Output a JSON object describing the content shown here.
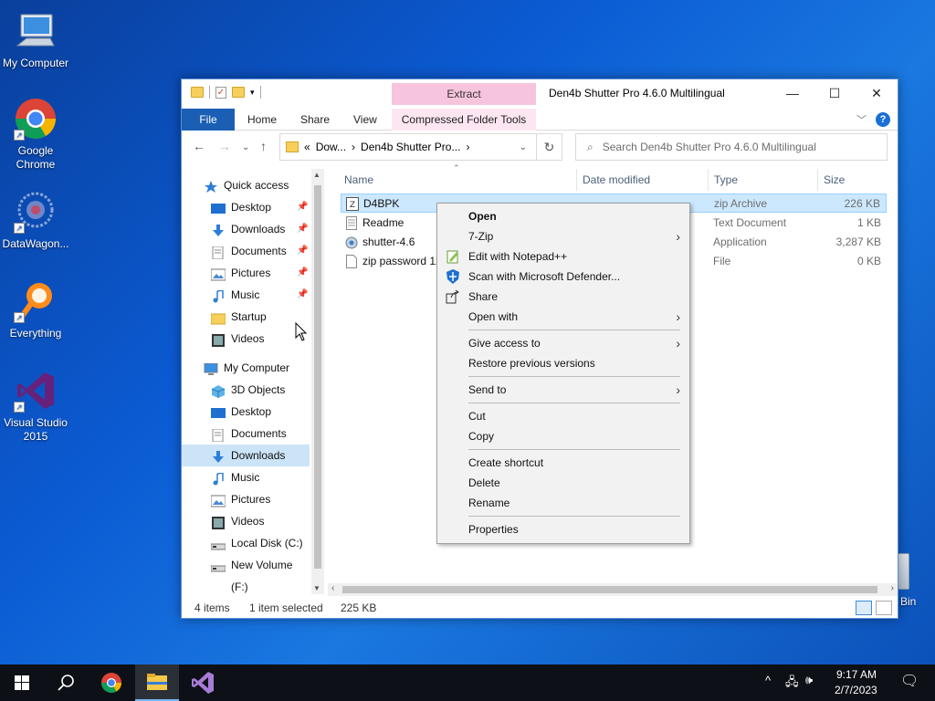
{
  "desktop": {
    "icons": [
      {
        "label": "My Computer",
        "icon": "computer-icon"
      },
      {
        "label": "Google Chrome",
        "icon": "chrome-icon"
      },
      {
        "label": "DataWagon...",
        "icon": "datawagon-icon"
      },
      {
        "label": "Everything",
        "icon": "everything-icon"
      },
      {
        "label": "Visual Studio 2015",
        "icon": "visual-studio-icon"
      }
    ],
    "recycle_bin_label": "Bin"
  },
  "window": {
    "title": "Den4b Shutter Pro 4.6.0 Multilingual",
    "context_tab": "Extract",
    "ribbon_tabs": [
      "File",
      "Home",
      "Share",
      "View",
      "Compressed Folder Tools"
    ],
    "address": {
      "crumb_prefix": "«",
      "parts": [
        "Dow...",
        "Den4b Shutter Pro..."
      ]
    },
    "search_placeholder": "Search Den4b Shutter Pro 4.6.0 Multilingual",
    "nav_pane": [
      {
        "label": "Quick access",
        "icon": "star-icon",
        "level": 0,
        "pinned": false
      },
      {
        "label": "Desktop",
        "icon": "desktop-icon",
        "level": 1,
        "pinned": true
      },
      {
        "label": "Downloads",
        "icon": "download-arrow-icon",
        "level": 1,
        "pinned": true
      },
      {
        "label": "Documents",
        "icon": "documents-icon",
        "level": 1,
        "pinned": true
      },
      {
        "label": "Pictures",
        "icon": "pictures-icon",
        "level": 1,
        "pinned": true
      },
      {
        "label": "Music",
        "icon": "music-icon",
        "level": 1,
        "pinned": true
      },
      {
        "label": "Startup",
        "icon": "folder-icon",
        "level": 1,
        "pinned": false
      },
      {
        "label": "Videos",
        "icon": "videos-icon",
        "level": 1,
        "pinned": false
      },
      {
        "label": "My Computer",
        "icon": "computer-icon",
        "level": 0,
        "pinned": false
      },
      {
        "label": "3D Objects",
        "icon": "3d-objects-icon",
        "level": 1,
        "pinned": false
      },
      {
        "label": "Desktop",
        "icon": "desktop-icon",
        "level": 1,
        "pinned": false
      },
      {
        "label": "Documents",
        "icon": "documents-icon",
        "level": 1,
        "pinned": false
      },
      {
        "label": "Downloads",
        "icon": "download-arrow-icon",
        "level": 1,
        "pinned": false,
        "selected": true
      },
      {
        "label": "Music",
        "icon": "music-icon",
        "level": 1,
        "pinned": false
      },
      {
        "label": "Pictures",
        "icon": "pictures-icon",
        "level": 1,
        "pinned": false
      },
      {
        "label": "Videos",
        "icon": "videos-icon",
        "level": 1,
        "pinned": false
      },
      {
        "label": "Local Disk (C:)",
        "icon": "drive-icon",
        "level": 1,
        "pinned": false
      },
      {
        "label": "New Volume (F:)",
        "icon": "drive-icon",
        "level": 1,
        "pinned": false
      }
    ],
    "columns": [
      "Name",
      "Date modified",
      "Type",
      "Size"
    ],
    "files": [
      {
        "name": "D4BPK",
        "type": "zip Archive",
        "size": "226 KB",
        "icon": "zip-icon",
        "selected": true
      },
      {
        "name": "Readme",
        "type": "Text Document",
        "size": "1 KB",
        "icon": "text-file-icon",
        "selected": false
      },
      {
        "name": "shutter-4.6",
        "type": "Application",
        "size": "3,287 KB",
        "icon": "installer-icon",
        "selected": false
      },
      {
        "name": "zip password 12",
        "type": "File",
        "size": "0 KB",
        "icon": "blank-file-icon",
        "selected": false
      }
    ],
    "status": {
      "count": "4 items",
      "selection": "1 item selected",
      "size": "225 KB"
    }
  },
  "context_menu": {
    "items": [
      {
        "label": "Open",
        "bold": true
      },
      {
        "label": "7-Zip",
        "submenu": true
      },
      {
        "label": "Edit with Notepad++",
        "icon": "notepad-plus-icon"
      },
      {
        "label": "Scan with Microsoft Defender...",
        "icon": "defender-icon"
      },
      {
        "label": "Share",
        "icon": "share-icon"
      },
      {
        "label": "Open with",
        "submenu": true
      },
      {
        "separator": true
      },
      {
        "label": "Give access to",
        "submenu": true
      },
      {
        "label": "Restore previous versions"
      },
      {
        "separator": true
      },
      {
        "label": "Send to",
        "submenu": true
      },
      {
        "separator": true
      },
      {
        "label": "Cut"
      },
      {
        "label": "Copy"
      },
      {
        "separator": true
      },
      {
        "label": "Create shortcut"
      },
      {
        "label": "Delete"
      },
      {
        "label": "Rename"
      },
      {
        "separator": true
      },
      {
        "label": "Properties"
      }
    ]
  },
  "taskbar": {
    "apps": [
      "start-button",
      "search-icon",
      "chrome-icon",
      "file-explorer-icon",
      "visual-studio-icon"
    ],
    "time": "9:17 AM",
    "date": "2/7/2023"
  },
  "colors": {
    "accent": "#1a5fb4",
    "selection": "#cce8ff",
    "extract_tab": "#f7c4de",
    "taskbar": "#0d1016"
  }
}
